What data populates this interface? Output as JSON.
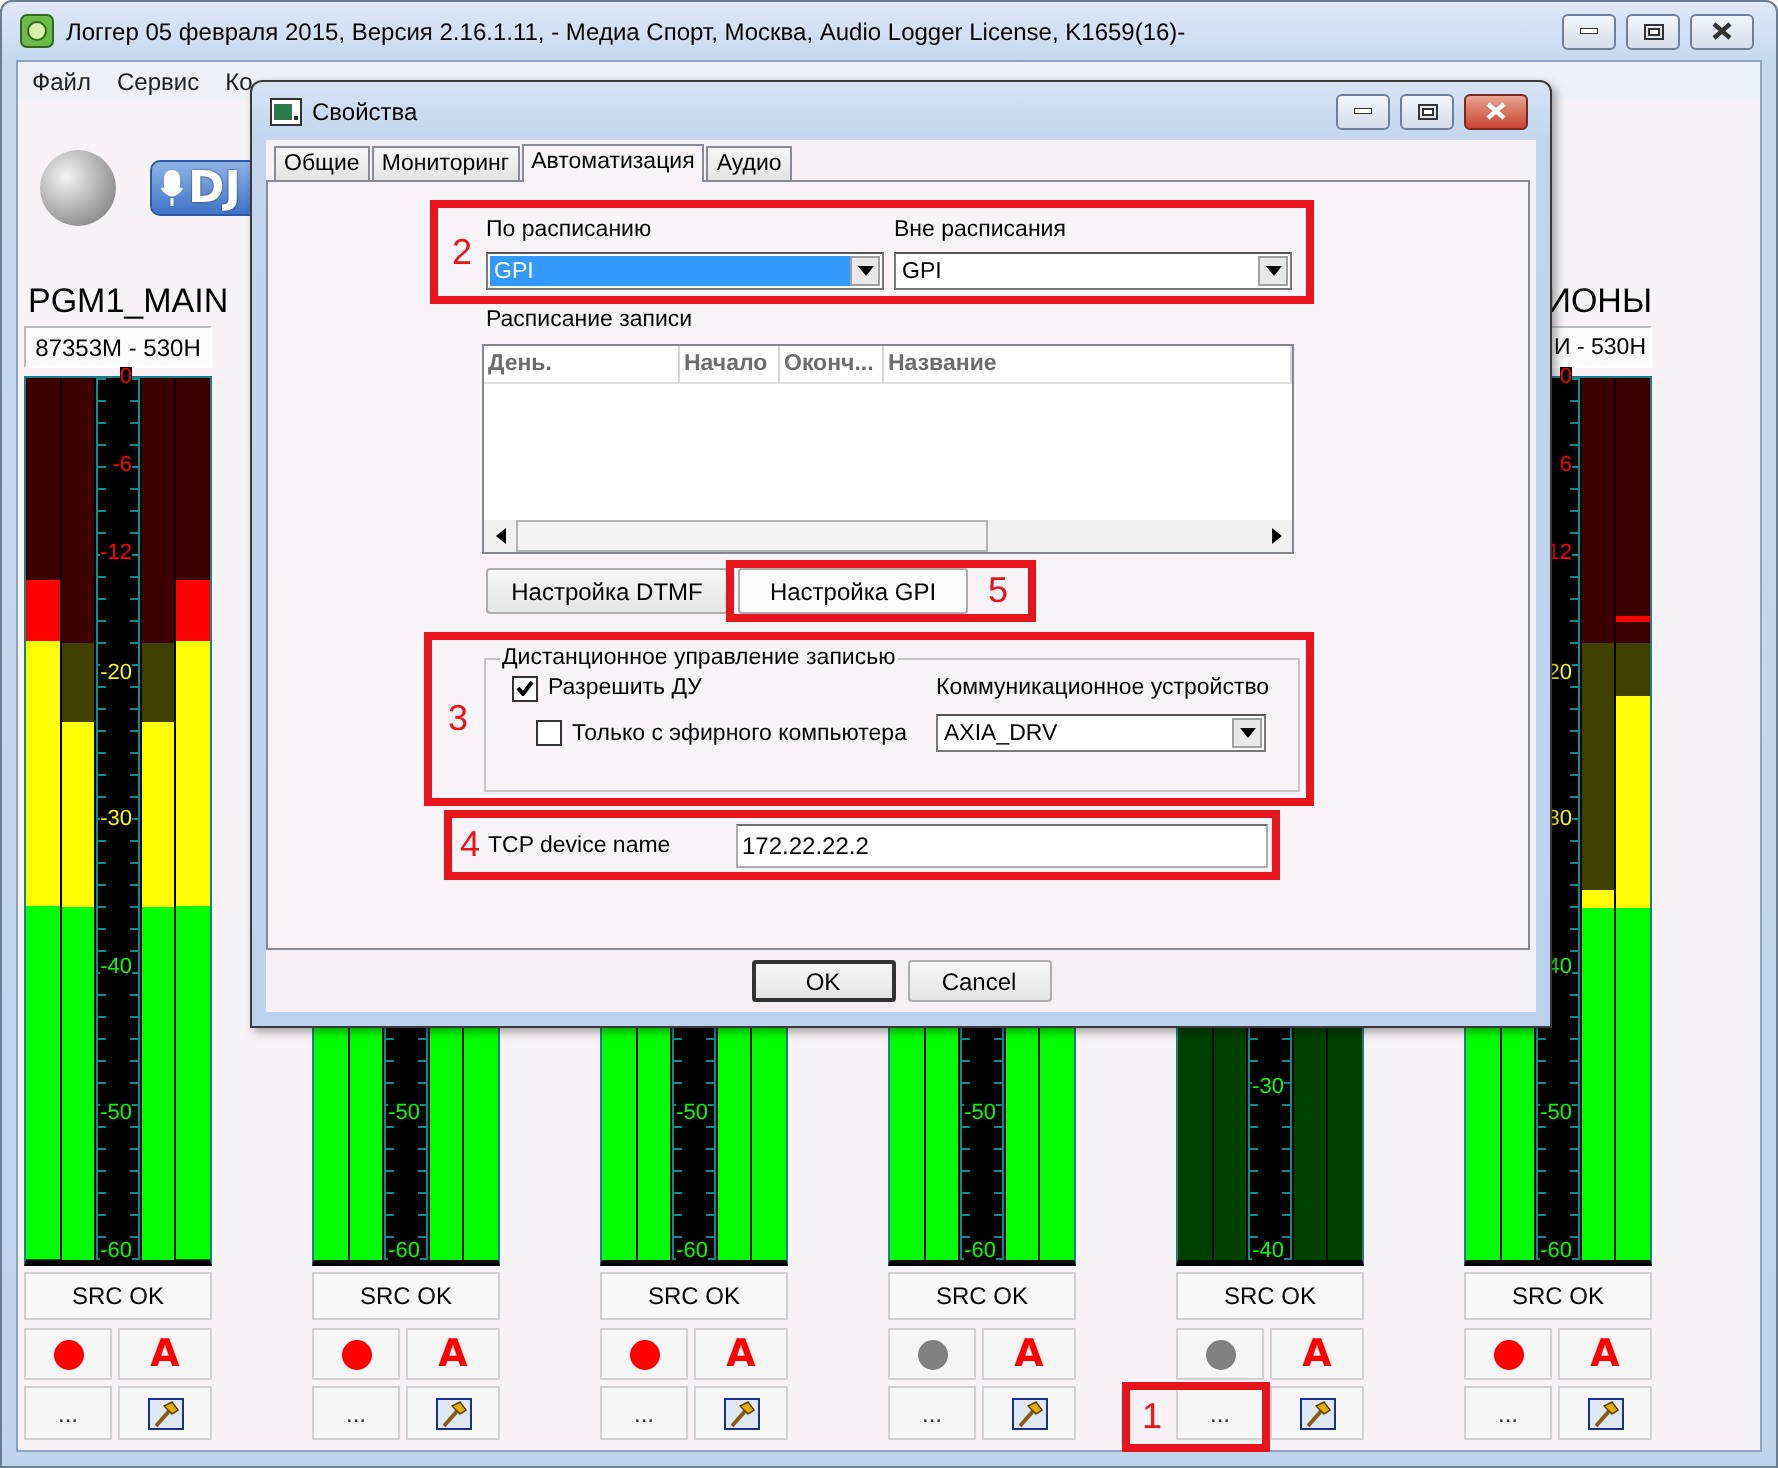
{
  "window": {
    "title": "Логгер 05 февраля 2015, Версия 2.16.1.11, - Медиа Спорт, Москва, Audio Logger License, K1659(16)-",
    "menu": [
      "Файл",
      "Сервис",
      "Ко"
    ]
  },
  "logo": {
    "text": "DJ"
  },
  "channels": [
    {
      "name": "PGM1_MAIN",
      "code": "87353M - 530H",
      "active": true,
      "kind": "full",
      "scale": [
        "0",
        "-6",
        "-12",
        "-20",
        "-30",
        "-40",
        "-50",
        "-60"
      ],
      "left_bars": [
        {
          "level": 0.77
        },
        {
          "level": 0.61
        }
      ],
      "right_bars": [
        {
          "level": 0.61
        },
        {
          "level": 0.77
        }
      ],
      "status": "SRC OK",
      "record": {
        "color": "#ff0000"
      },
      "auto_label": "A",
      "more_label": "..."
    },
    {
      "active": true,
      "kind": "full",
      "scale": [
        "-50",
        "-60"
      ],
      "status": "SRC OK",
      "record": {
        "color": "#ff0000"
      },
      "auto_label": "A",
      "more_label": "..."
    },
    {
      "active": true,
      "kind": "full",
      "scale": [
        "-50",
        "-60"
      ],
      "status": "SRC OK",
      "record": {
        "color": "#ff0000"
      },
      "auto_label": "A",
      "more_label": "..."
    },
    {
      "active": true,
      "kind": "full",
      "scale": [
        "-50",
        "-60"
      ],
      "status": "SRC OK",
      "record": {
        "color": "#808080"
      },
      "auto_label": "A",
      "more_label": "..."
    },
    {
      "active": false,
      "kind": "short",
      "scale": [
        "-30",
        "-40"
      ],
      "status": "SRC OK",
      "record": {
        "color": "#808080"
      },
      "auto_label": "A",
      "more_label": "...",
      "more_annotation": "1"
    },
    {
      "name": "ИОНЫ",
      "code": "И - 530Н",
      "active": true,
      "kind": "full",
      "scale": [
        "0",
        "6",
        "12",
        "20",
        "30",
        "40",
        "-50",
        "-60"
      ],
      "right_bars": [
        {
          "level": 0.42
        },
        {
          "level": 0.64,
          "peak": {
            "level": 0.73
          }
        }
      ],
      "status": "SRC OK",
      "record": {
        "color": "#ff0000"
      },
      "auto_label": "A",
      "more_label": "..."
    }
  ],
  "dialog": {
    "title": "Свойства",
    "tabs": [
      {
        "label": "Общие",
        "selected": false
      },
      {
        "label": "Мониторинг",
        "selected": false
      },
      {
        "label": "Автоматизация",
        "selected": true
      },
      {
        "label": "Аудио",
        "selected": false
      }
    ],
    "mode_group": {
      "annotation": "2",
      "fields": [
        {
          "label": "По расписанию",
          "value": "GPI",
          "focused": true
        },
        {
          "label": "Вне расписания",
          "value": "GPI",
          "focused": false
        }
      ]
    },
    "schedule": {
      "label": "Расписание записи",
      "columns": [
        "День.",
        "Начало",
        "Оконч...",
        "Название"
      ]
    },
    "buttons": [
      {
        "label": "Настройка DTMF"
      },
      {
        "label": "Настройка GPI",
        "annotation": "5"
      }
    ],
    "remote_control": {
      "annotation": "3",
      "title": "Дистанционное управление записью",
      "checkboxes": [
        {
          "label": "Разрешить ДУ",
          "checked": true
        },
        {
          "label": "Только с эфирного компьютера",
          "checked": false
        }
      ],
      "device_label": "Коммуникационное устройство",
      "device": "AXIA_DRV"
    },
    "tcp": {
      "annotation": "4",
      "label": "TCP device name",
      "value": "172.22.22.2"
    },
    "footer_buttons": [
      {
        "label": "OK",
        "default": true
      },
      {
        "label": "Cancel",
        "default": false
      }
    ]
  }
}
